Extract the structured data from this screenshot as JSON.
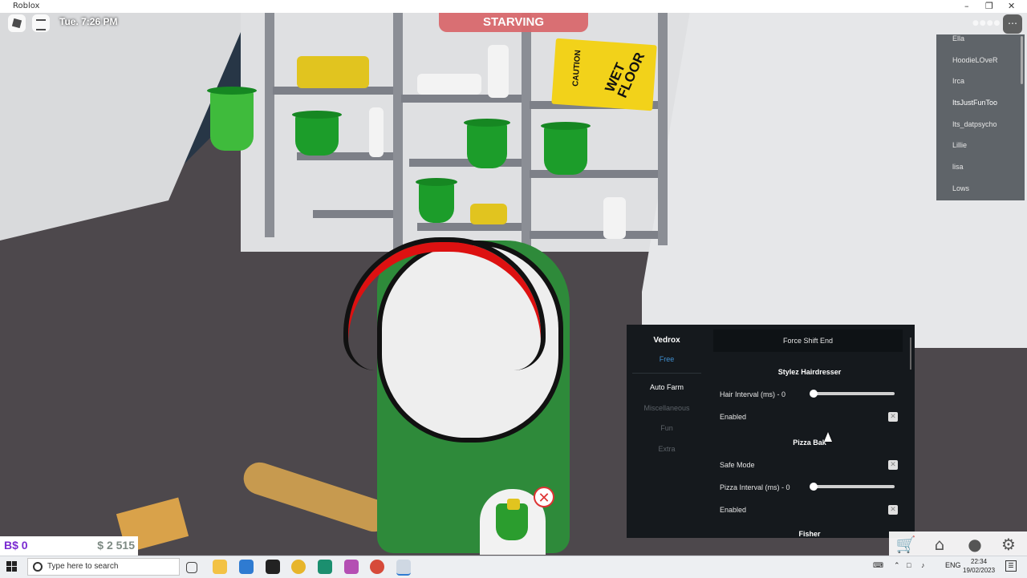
{
  "window": {
    "title": "Roblox"
  },
  "hud": {
    "clock": "Tue. 7:26 PM",
    "status": "STARVING",
    "bux": "B$ 0",
    "cash": "$ 2 515"
  },
  "players": [
    "Ella",
    "HoodieLOveR",
    "Irca",
    "ItsJustFunToo",
    "Its_datpsycho",
    "Lillie",
    "lisa",
    "Lows"
  ],
  "scene": {
    "sign_text": "WET FLOOR",
    "sign_caution": "CAUTION"
  },
  "panel": {
    "brand": "Vedrox",
    "tier": "Free",
    "tabs": [
      "Auto Farm",
      "Miscellaneous",
      "Fun",
      "Extra"
    ],
    "force_shift_end": "Force Shift End",
    "section1": "Stylez Hairdresser",
    "hair_interval_label": "Hair Interval (ms) - 0",
    "hair_interval_value": 0,
    "enabled_label_1": "Enabled",
    "section2": "Pizza Bak",
    "safe_mode_label": "Safe Mode",
    "pizza_interval_label": "Pizza Interval (ms) - 0",
    "pizza_interval_value": 0,
    "enabled_label_2": "Enabled",
    "section3": "Fisher"
  },
  "taskbar": {
    "search_placeholder": "Type here to search",
    "lang": "ENG",
    "time": "22:34",
    "date": "19/02/2023"
  },
  "colors": {
    "status_banner": "#d96a6e",
    "bux": "#7a2ad1",
    "accent": "#3f8fd0"
  }
}
